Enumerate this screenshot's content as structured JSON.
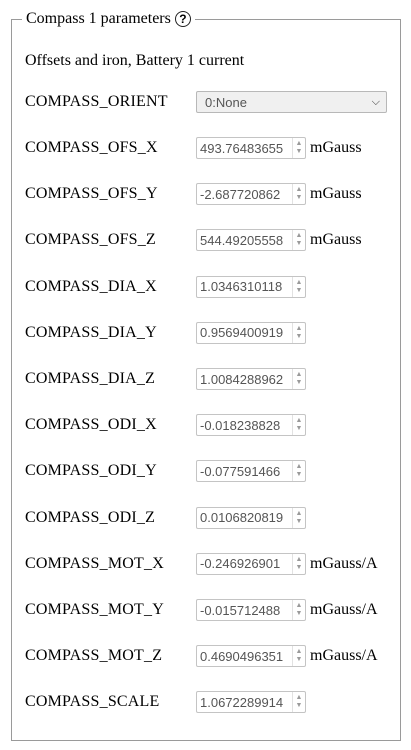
{
  "panel": {
    "title": "Compass 1 parameters",
    "help_symbol": "?",
    "subtitle": "Offsets and iron, Battery 1 current"
  },
  "orient": {
    "label": "COMPASS_ORIENT",
    "selected": "0:None"
  },
  "params": [
    {
      "label": "COMPASS_OFS_X",
      "value": "493.76483655",
      "unit": "mGauss"
    },
    {
      "label": "COMPASS_OFS_Y",
      "value": "-2.687720862",
      "unit": "mGauss"
    },
    {
      "label": "COMPASS_OFS_Z",
      "value": "544.49205558",
      "unit": "mGauss"
    },
    {
      "label": "COMPASS_DIA_X",
      "value": "1.0346310118",
      "unit": ""
    },
    {
      "label": "COMPASS_DIA_Y",
      "value": "0.9569400919",
      "unit": ""
    },
    {
      "label": "COMPASS_DIA_Z",
      "value": "1.0084288962",
      "unit": ""
    },
    {
      "label": "COMPASS_ODI_X",
      "value": "-0.018238828",
      "unit": ""
    },
    {
      "label": "COMPASS_ODI_Y",
      "value": "-0.077591466",
      "unit": ""
    },
    {
      "label": "COMPASS_ODI_Z",
      "value": "0.0106820819",
      "unit": ""
    },
    {
      "label": "COMPASS_MOT_X",
      "value": "-0.246926901",
      "unit": "mGauss/A"
    },
    {
      "label": "COMPASS_MOT_Y",
      "value": "-0.015712488",
      "unit": "mGauss/A"
    },
    {
      "label": "COMPASS_MOT_Z",
      "value": "0.4690496351",
      "unit": "mGauss/A"
    },
    {
      "label": "COMPASS_SCALE",
      "value": "1.0672289914",
      "unit": ""
    }
  ]
}
